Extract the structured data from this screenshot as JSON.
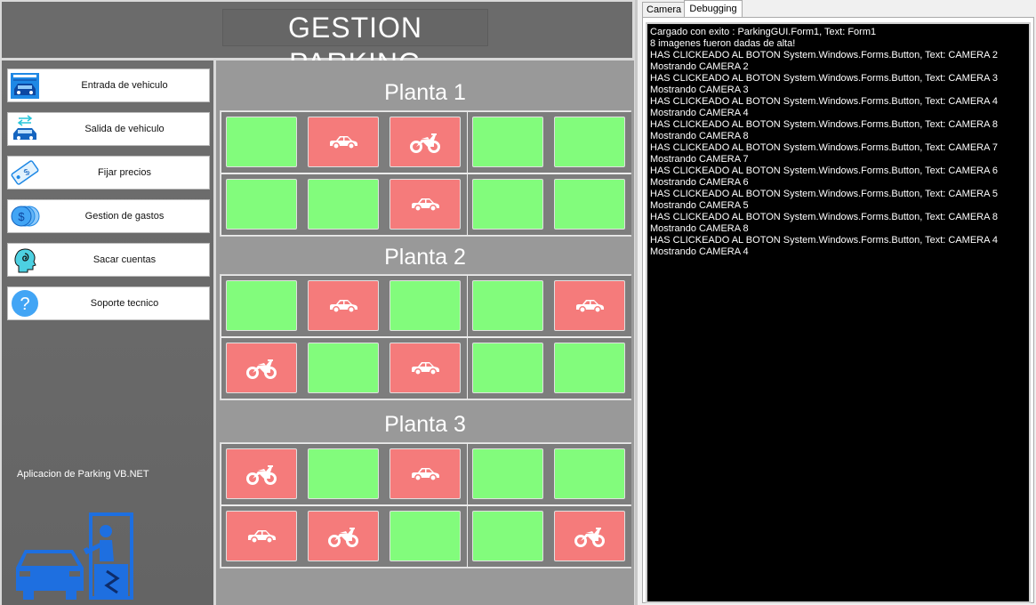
{
  "header": {
    "title": "GESTION PARKING"
  },
  "menu": [
    {
      "label": "Entrada de vehiculo",
      "icon": "garage-car-icon"
    },
    {
      "label": "Salida de vehiculo",
      "icon": "car-exit-arrows-icon"
    },
    {
      "label": "Fijar precios",
      "icon": "price-tag-icon"
    },
    {
      "label": "Gestion de gastos",
      "icon": "coins-icon"
    },
    {
      "label": "Sacar cuentas",
      "icon": "head-thinking-icon"
    },
    {
      "label": "Soporte tecnico",
      "icon": "help-question-icon"
    }
  ],
  "app_label": "Aplicacion de Parking VB.NET",
  "plantas": [
    {
      "title": "Planta 1",
      "rows": [
        [
          "free",
          "car",
          "moto",
          "free",
          "free"
        ],
        [
          "free",
          "free",
          "car",
          "free",
          "free"
        ]
      ]
    },
    {
      "title": "Planta 2",
      "rows": [
        [
          "free",
          "car",
          "free",
          "free",
          "car"
        ],
        [
          "moto",
          "free",
          "car",
          "free",
          "free"
        ]
      ]
    },
    {
      "title": "Planta 3",
      "rows": [
        [
          "moto",
          "free",
          "car",
          "free",
          "free"
        ],
        [
          "car",
          "moto",
          "free",
          "free",
          "moto"
        ]
      ]
    }
  ],
  "colors": {
    "free": "#82fc7c",
    "occupied": "#f57b7b"
  },
  "tabs": {
    "camera": "Camera",
    "debugging": "Debugging",
    "active": "Debugging"
  },
  "console_lines": [
    "Cargado con exito : ParkingGUI.Form1, Text: Form1",
    "8 imagenes fueron dadas de alta!",
    "HAS CLICKEADO AL BOTON System.Windows.Forms.Button, Text: CAMERA 2",
    "Mostrando CAMERA 2",
    "HAS CLICKEADO AL BOTON System.Windows.Forms.Button, Text: CAMERA 3",
    "Mostrando CAMERA 3",
    "HAS CLICKEADO AL BOTON System.Windows.Forms.Button, Text: CAMERA 4",
    "Mostrando CAMERA 4",
    "HAS CLICKEADO AL BOTON System.Windows.Forms.Button, Text: CAMERA 8",
    "Mostrando CAMERA 8",
    "HAS CLICKEADO AL BOTON System.Windows.Forms.Button, Text: CAMERA 7",
    "Mostrando CAMERA 7",
    "HAS CLICKEADO AL BOTON System.Windows.Forms.Button, Text: CAMERA 6",
    "Mostrando CAMERA 6",
    "HAS CLICKEADO AL BOTON System.Windows.Forms.Button, Text: CAMERA 5",
    "Mostrando CAMERA 5",
    "HAS CLICKEADO AL BOTON System.Windows.Forms.Button, Text: CAMERA 8",
    "Mostrando CAMERA 8",
    "HAS CLICKEADO AL BOTON System.Windows.Forms.Button, Text: CAMERA 4",
    "Mostrando CAMERA 4"
  ]
}
